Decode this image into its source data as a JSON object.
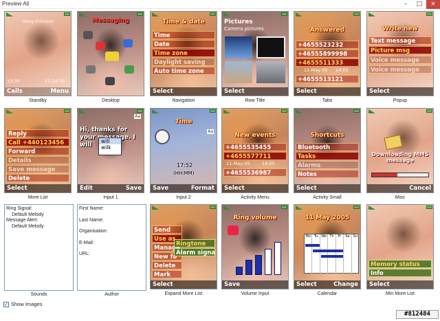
{
  "window": {
    "title": "Preview All",
    "min": "–",
    "max": "□",
    "close": "×"
  },
  "cells": {
    "standby": {
      "caption": "Standby",
      "name": "Sony Ericsson",
      "time": "13:30",
      "date": "11-Jul-05",
      "left": "Calls",
      "right": "Menu"
    },
    "desktop": {
      "caption": "Desktop",
      "header": "Messaging"
    },
    "navigation": {
      "caption": "Navigation",
      "header": "Time & date",
      "items": [
        "Time",
        "Date",
        "Time zone",
        "Daylight saving",
        "Auto time zone"
      ],
      "left": "Select"
    },
    "row_title": {
      "caption": "Row Title",
      "header": "Pictures",
      "sub": "Camera pictures",
      "left": "Select"
    },
    "tabs": {
      "caption": "Tabs",
      "header": "Answered",
      "items": [
        "+4655523232",
        "+46555899998",
        "+4655511333",
        "+4655513121"
      ],
      "dt": "11-May-05",
      "tm": "14:05",
      "left": "Select"
    },
    "popup": {
      "caption": "Popup",
      "header": "Write new",
      "items": [
        "Text message",
        "Picture msg",
        "Voice message",
        "Voice message"
      ],
      "left": "Select"
    },
    "more_list": {
      "caption": "More List",
      "items": [
        "Reply",
        "Call +440123456",
        "Forward",
        "Details",
        "Save message",
        "Delete"
      ],
      "left": "Select"
    },
    "input1": {
      "caption": "Input 1",
      "text": "Hi, thanks for your message. I will",
      "opt1": "will",
      "opt2": "wilk",
      "badge": "Aa",
      "left": "Edit",
      "right": "Save"
    },
    "input2": {
      "caption": "Input 2",
      "header": "Time",
      "badge": "Aa",
      "time": "17:52",
      "fmt": "(HH:MM)",
      "left": "Save",
      "right": "Format"
    },
    "activity_menu": {
      "caption": "Activity Menu",
      "header": "New events",
      "items": [
        "+4655535455",
        "+4655577711",
        "+4655536987"
      ],
      "dt": "11-May-05",
      "tm": "14:05",
      "left": "Select"
    },
    "activity_small": {
      "caption": "Activity Small",
      "header": "Shortcuts",
      "items": [
        "Bluetooth",
        "Tasks",
        "Alarms",
        "Notes"
      ],
      "left": "Select"
    },
    "misc": {
      "caption": "Misc",
      "text": "Downloading MMS message",
      "right": "Cancel"
    },
    "sounds": {
      "caption": "Sounds",
      "lines": [
        "Ring Signal:",
        "Default Melody",
        "Message Alert:",
        "Default Melody"
      ]
    },
    "author": {
      "caption": "Author",
      "lines": [
        "First Name:",
        "Last Name:",
        "Organisation:",
        "E-Mail:",
        "URL:"
      ]
    },
    "expand_more": {
      "caption": "Expand More List",
      "items": [
        "Send",
        "Use as",
        "Manage",
        "New fo",
        "Delete",
        "Mark"
      ],
      "sub": [
        "Ringtone",
        "Alarm signal"
      ],
      "left": "Select"
    },
    "volume": {
      "caption": "Volume Input",
      "header": "Ring volume",
      "levels": [
        0.25,
        0.45,
        0.6,
        0.8,
        1.0
      ],
      "left": "Save"
    },
    "calendar": {
      "caption": "Calendar",
      "header": "11 May 2005",
      "days": [
        "Mo",
        "Tu",
        "We",
        "Th",
        "Fr",
        "Sa",
        "Su"
      ],
      "left": "Select",
      "right": "Change"
    },
    "min_more": {
      "caption": "Min More List",
      "items": [
        "Memory status",
        "Info"
      ],
      "left": "Select"
    }
  },
  "footer": {
    "show_images": "Show Images",
    "checked": true,
    "check_glyph": "✓"
  },
  "watermark": "#812484"
}
